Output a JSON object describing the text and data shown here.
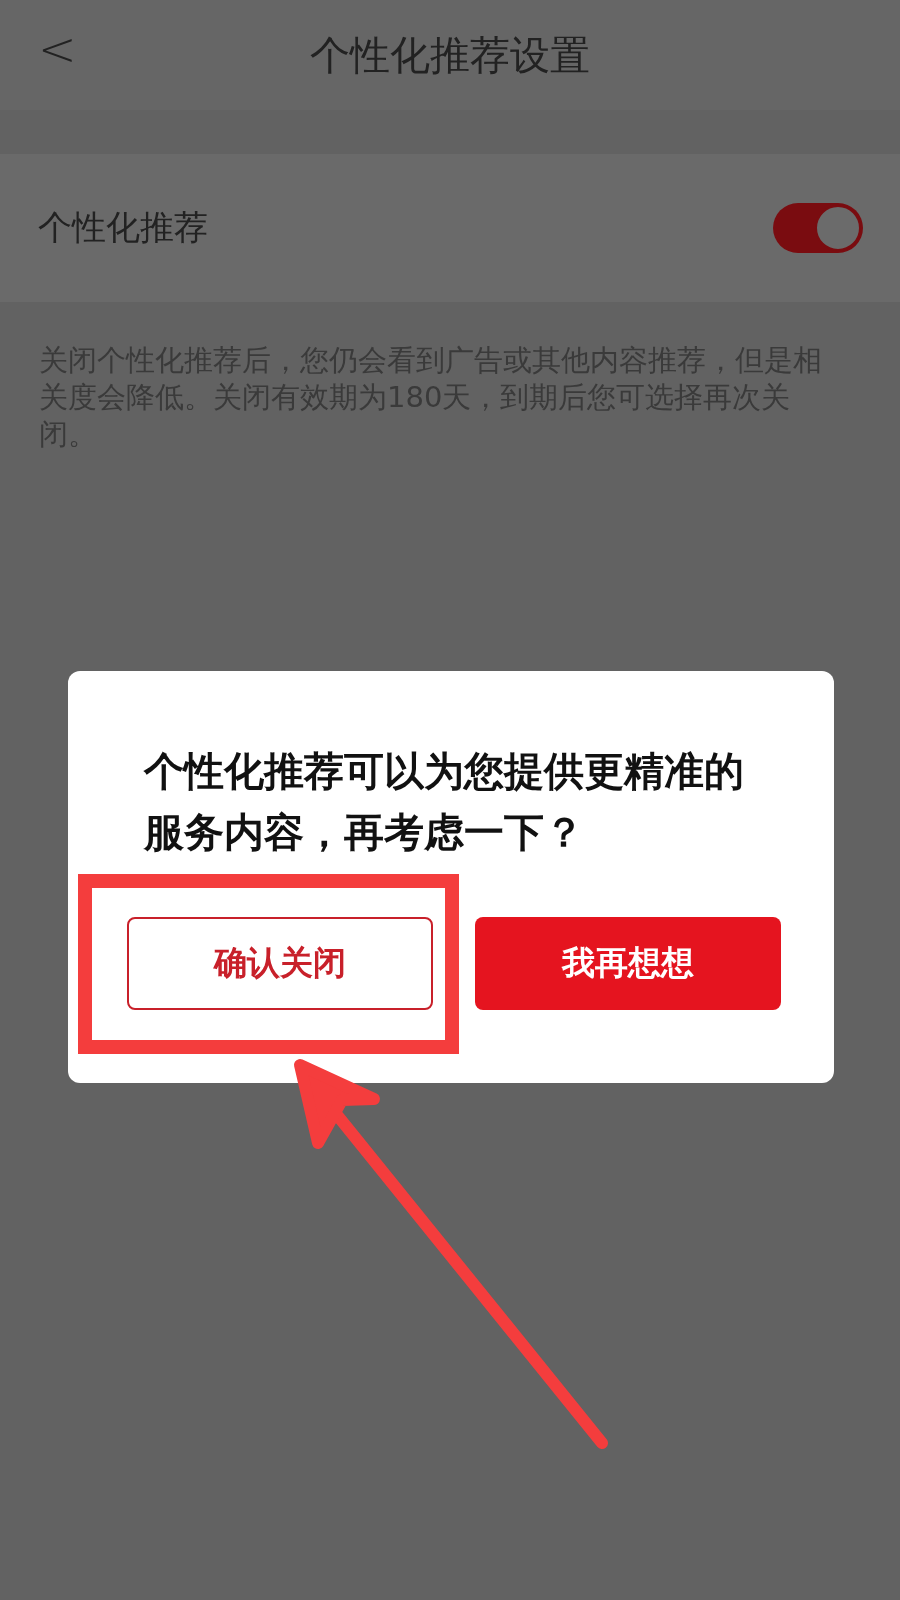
{
  "header": {
    "back": "<",
    "title": "个性化推荐设置"
  },
  "settings": {
    "label": "个性化推荐",
    "on": true
  },
  "description": "关闭个性化推荐后，您仍会看到广告或其他内容推荐，但是相关度会降低。关闭有效期为180天，到期后您可选择再次关闭。",
  "dialog": {
    "message": "个性化推荐可以为您提供更精准的服务内容，再考虑一下？",
    "buttons": [
      {
        "label": "确认关闭",
        "kind": "outline"
      },
      {
        "label": "我再想想",
        "kind": "primary"
      }
    ]
  }
}
